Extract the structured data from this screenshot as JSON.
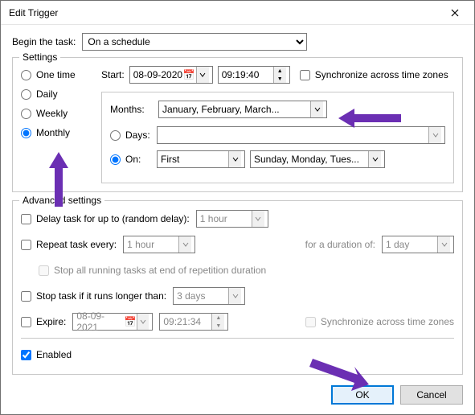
{
  "window": {
    "title": "Edit Trigger"
  },
  "begin": {
    "label": "Begin the task:",
    "value": "On a schedule"
  },
  "settings": {
    "legend": "Settings",
    "recurrence": {
      "onetime": "One time",
      "daily": "Daily",
      "weekly": "Weekly",
      "monthly": "Monthly",
      "selected": "monthly"
    },
    "start": {
      "label": "Start:",
      "date": "08-09-2020",
      "time": "09:19:40"
    },
    "sync": {
      "label": "Synchronize across time zones",
      "checked": false
    },
    "months": {
      "label": "Months:",
      "value": "January, February, March..."
    },
    "days": {
      "label": "Days:",
      "value": "",
      "selected": false
    },
    "on": {
      "label": "On:",
      "which": "First",
      "weekdays": "Sunday, Monday, Tues...",
      "selected": true
    }
  },
  "adv": {
    "legend": "Advanced settings",
    "delay": {
      "label": "Delay task for up to (random delay):",
      "value": "1 hour",
      "checked": false
    },
    "repeat": {
      "label": "Repeat task every:",
      "value": "1 hour",
      "duration_label": "for a duration of:",
      "duration_value": "1 day",
      "checked": false
    },
    "stop_repetition": {
      "label": "Stop all running tasks at end of repetition duration",
      "checked": false
    },
    "stop_longer": {
      "label": "Stop task if it runs longer than:",
      "value": "3 days",
      "checked": false
    },
    "expire": {
      "label": "Expire:",
      "date": "08-09-2021",
      "time": "09:21:34",
      "sync_label": "Synchronize across time zones",
      "checked": false
    },
    "enabled": {
      "label": "Enabled",
      "checked": true
    }
  },
  "buttons": {
    "ok": "OK",
    "cancel": "Cancel"
  }
}
